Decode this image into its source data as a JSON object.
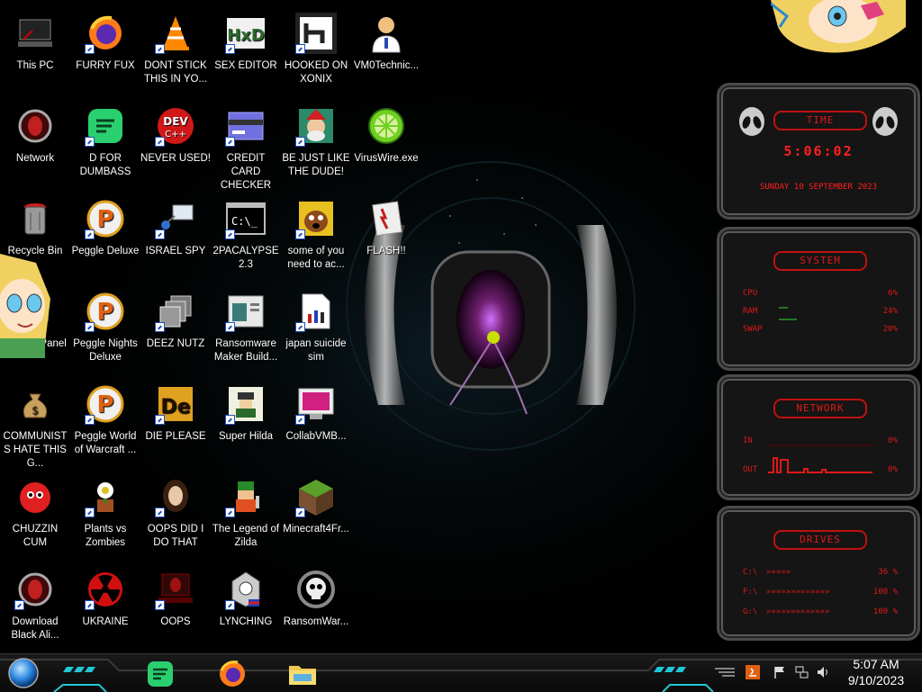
{
  "desktop_icons": [
    {
      "label": "This PC",
      "icon": "computer-icon",
      "shortcut": false
    },
    {
      "label": "FURRY FUX",
      "icon": "firefox-icon",
      "shortcut": true
    },
    {
      "label": "DONT STICK THIS IN YO...",
      "icon": "vlc-cone-icon",
      "shortcut": true
    },
    {
      "label": "SEX EDITOR",
      "icon": "hxd-editor-icon",
      "shortcut": true
    },
    {
      "label": "HOOKED ON XONIX",
      "icon": "xonix-icon",
      "shortcut": true
    },
    {
      "label": "VM0Technic...",
      "icon": "doctor-icon",
      "shortcut": false
    },
    {
      "label": "Network",
      "icon": "network-alien-icon",
      "shortcut": false
    },
    {
      "label": "D FOR DUMBASS",
      "icon": "spotify-green-icon",
      "shortcut": true
    },
    {
      "label": "NEVER USED!",
      "icon": "devcpp-icon",
      "shortcut": true
    },
    {
      "label": "CREDIT CARD CHECKER",
      "icon": "card-window-icon",
      "shortcut": true
    },
    {
      "label": "BE JUST LIKE THE DUDE!",
      "icon": "elf-icon",
      "shortcut": true
    },
    {
      "label": "VirusWire.exe",
      "icon": "lime-icon",
      "shortcut": false
    },
    {
      "label": "Recycle Bin",
      "icon": "recycle-bin-icon",
      "shortcut": false
    },
    {
      "label": "Peggle Deluxe",
      "icon": "peggle-icon",
      "shortcut": true
    },
    {
      "label": "ISRAEL SPY",
      "icon": "spy-network-icon",
      "shortcut": true
    },
    {
      "label": "2PACALYPSE 2.3",
      "icon": "terminal-icon",
      "shortcut": true
    },
    {
      "label": "some of you need to ac...",
      "icon": "dog-icon",
      "shortcut": true
    },
    {
      "label": "FLASH!!",
      "icon": "flash-icon",
      "shortcut": false
    },
    {
      "label": "Control Panel",
      "icon": "control-panel-icon",
      "shortcut": false
    },
    {
      "label": "Peggle Nights Deluxe",
      "icon": "peggle-icon",
      "shortcut": true
    },
    {
      "label": "DEEZ NUTZ",
      "icon": "stack-windows-icon",
      "shortcut": true
    },
    {
      "label": "Ransomware Maker Build...",
      "icon": "builder-window-icon",
      "shortcut": true
    },
    {
      "label": "japan suicide sim",
      "icon": "document-icon",
      "shortcut": true
    },
    {
      "label": "COMMUNISTS HATE THIS G...",
      "icon": "money-bag-icon",
      "shortcut": false
    },
    {
      "label": "Peggle World of Warcraft ...",
      "icon": "peggle-icon",
      "shortcut": true
    },
    {
      "label": "DIE PLEASE",
      "icon": "de-icon",
      "shortcut": true
    },
    {
      "label": "Super Hilda",
      "icon": "pixel-hilda-icon",
      "shortcut": true
    },
    {
      "label": "CollabVMB...",
      "icon": "collab-vm-icon",
      "shortcut": true
    },
    {
      "label": "CHUZZIN CUM",
      "icon": "chuzzle-icon",
      "shortcut": false
    },
    {
      "label": "Plants vs Zombies",
      "icon": "plant-icon",
      "shortcut": true
    },
    {
      "label": "OOPS DID I DO THAT",
      "icon": "portrait-icon",
      "shortcut": true
    },
    {
      "label": "The Legend of Zilda",
      "icon": "zilda-icon",
      "shortcut": true
    },
    {
      "label": "Minecraft4Fr...",
      "icon": "grass-block-icon",
      "shortcut": true
    },
    {
      "label": "Download Black Ali...",
      "icon": "network-alien-icon",
      "shortcut": true
    },
    {
      "label": "UKRAINE",
      "icon": "radiation-icon",
      "shortcut": true
    },
    {
      "label": "OOPS",
      "icon": "alien-laptop-icon",
      "shortcut": true
    },
    {
      "label": "LYNCHING",
      "icon": "lynch-icon",
      "shortcut": true
    },
    {
      "label": "RansomWar...",
      "icon": "skull-icon",
      "shortcut": false
    }
  ],
  "widgets": {
    "time": {
      "title": "TIME",
      "clock": "5:06:02",
      "date": "SUNDAY 10 SEPTEMBER 2023"
    },
    "system": {
      "title": "SYSTEM",
      "rows": [
        {
          "key": "CPU",
          "value": "6%"
        },
        {
          "key": "RAM",
          "value": "24%"
        },
        {
          "key": "SWAP",
          "value": "20%"
        }
      ]
    },
    "network": {
      "title": "NETWORK",
      "rows": [
        {
          "key": "IN",
          "value": "0%"
        },
        {
          "key": "OUT",
          "value": "0%"
        }
      ]
    },
    "drives": {
      "title": "DRIVES",
      "rows": [
        {
          "key": "C:\\",
          "value": "36 %"
        },
        {
          "key": "F:\\",
          "value": "100 %"
        },
        {
          "key": "G:\\",
          "value": "100 %"
        }
      ]
    }
  },
  "taskbar": {
    "start": "start-orb-icon",
    "pinned": [
      "spotify-icon",
      "firefox-icon",
      "file-explorer-icon"
    ],
    "tray": [
      "show-hidden-icon",
      "java-update-icon",
      "flag-icon",
      "network-tray-icon",
      "volume-icon"
    ],
    "time": "5:07 AM",
    "date": "9/10/2023"
  },
  "colors": {
    "accent_red": "#e01818",
    "panel_bg": "#151515",
    "taskbar_bg": "#111111"
  }
}
